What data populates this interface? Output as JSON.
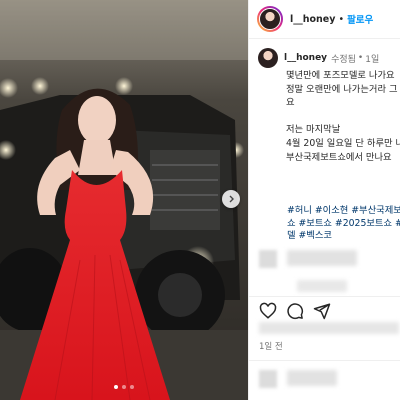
{
  "post": {
    "username": "l__honey",
    "separator": "•",
    "follow_label": "팔로우"
  },
  "caption": {
    "username": "l__honey",
    "edited_label": "수정됨",
    "dot": "•",
    "time_ago": "1일",
    "text_lines": [
      "몇년만에 포즈모델로 나가요",
      "정말 오랜만에 나가는거라 그",
      "요",
      "",
      "저는 마지막날",
      "4월 20일 일요일 단 하루만 나",
      "부산국제보트쇼에서 만나요"
    ],
    "hashtag_lines": [
      "#허니 #이소현 #부산국제보트",
      "쇼 #보트쇼 #2025보트쇼 #보트",
      "델 #벡스코"
    ]
  },
  "footer": {
    "posted_ago": "1일 전"
  },
  "carousel": {
    "slide_count": 3,
    "active_index": 0
  },
  "icons": [
    "heart-icon",
    "comment-icon",
    "share-icon",
    "chevron-right-icon"
  ],
  "colors": {
    "follow_blue": "#0095f6",
    "hashtag_blue": "#00376b",
    "dress_red": "#e8262e"
  }
}
